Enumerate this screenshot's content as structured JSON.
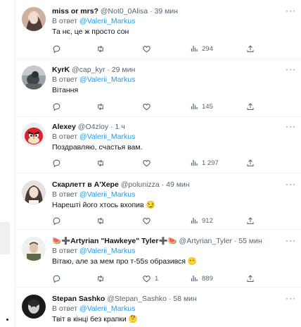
{
  "tweets": [
    {
      "name": "miss or mrs?",
      "handle": "@Not0_0Alisa",
      "time": "· 39 мин",
      "reply_prefix": "В ответ",
      "reply_to": "@Valerii_Markus",
      "text": "Та нє, це ж просто сон",
      "replies": "",
      "retweets": "",
      "likes": "",
      "views": "294"
    },
    {
      "name": "KyrK",
      "handle": "@cap_kyr",
      "time": "· 29 мин",
      "reply_prefix": "В ответ",
      "reply_to": "@Valerii_Markus",
      "text": "Вітання",
      "replies": "",
      "retweets": "",
      "likes": "",
      "views": "145"
    },
    {
      "name": "Alexey",
      "handle": "@O4zloy",
      "time": "· 1 ч",
      "reply_prefix": "В ответ",
      "reply_to": "@Valerii_Markus",
      "text": "Поздравляю, счастья вам.",
      "replies": "",
      "retweets": "",
      "likes": "",
      "views": "1 297"
    },
    {
      "name": "Скарлетт в А'Хере",
      "handle": "@polunizza",
      "time": "· 49 мин",
      "reply_prefix": "В ответ",
      "reply_to": "@Valerii_Markus",
      "text": "Нарешті його хтось вхопив 😏",
      "replies": "",
      "retweets": "",
      "likes": "",
      "views": "912"
    },
    {
      "name": "🍉➕Artyrian \"Hawkeye\" Tyler➕🍉",
      "handle": "@Artyrian_Tyler",
      "time": "· 55 мин",
      "reply_prefix": "В ответ",
      "reply_to": "@Valerii_Markus",
      "text": "Вітаю, але за мем про т-55s образився 😶",
      "replies": "",
      "retweets": "",
      "likes": "1",
      "views": "889"
    },
    {
      "name": "Stepan Sashko",
      "handle": "@Stepan_Sashko",
      "time": "· 58 мин",
      "reply_prefix": "В ответ",
      "reply_to": "@Valerii_Markus",
      "text": "Твіт в кінці без крапки 🤔",
      "replies": "",
      "retweets": "",
      "likes": "",
      "views": ""
    }
  ],
  "more_glyph": "···",
  "colors": {
    "accent": "#1d9bf0",
    "muted": "#536471",
    "text": "#0f1419",
    "border": "#eff3f4"
  }
}
